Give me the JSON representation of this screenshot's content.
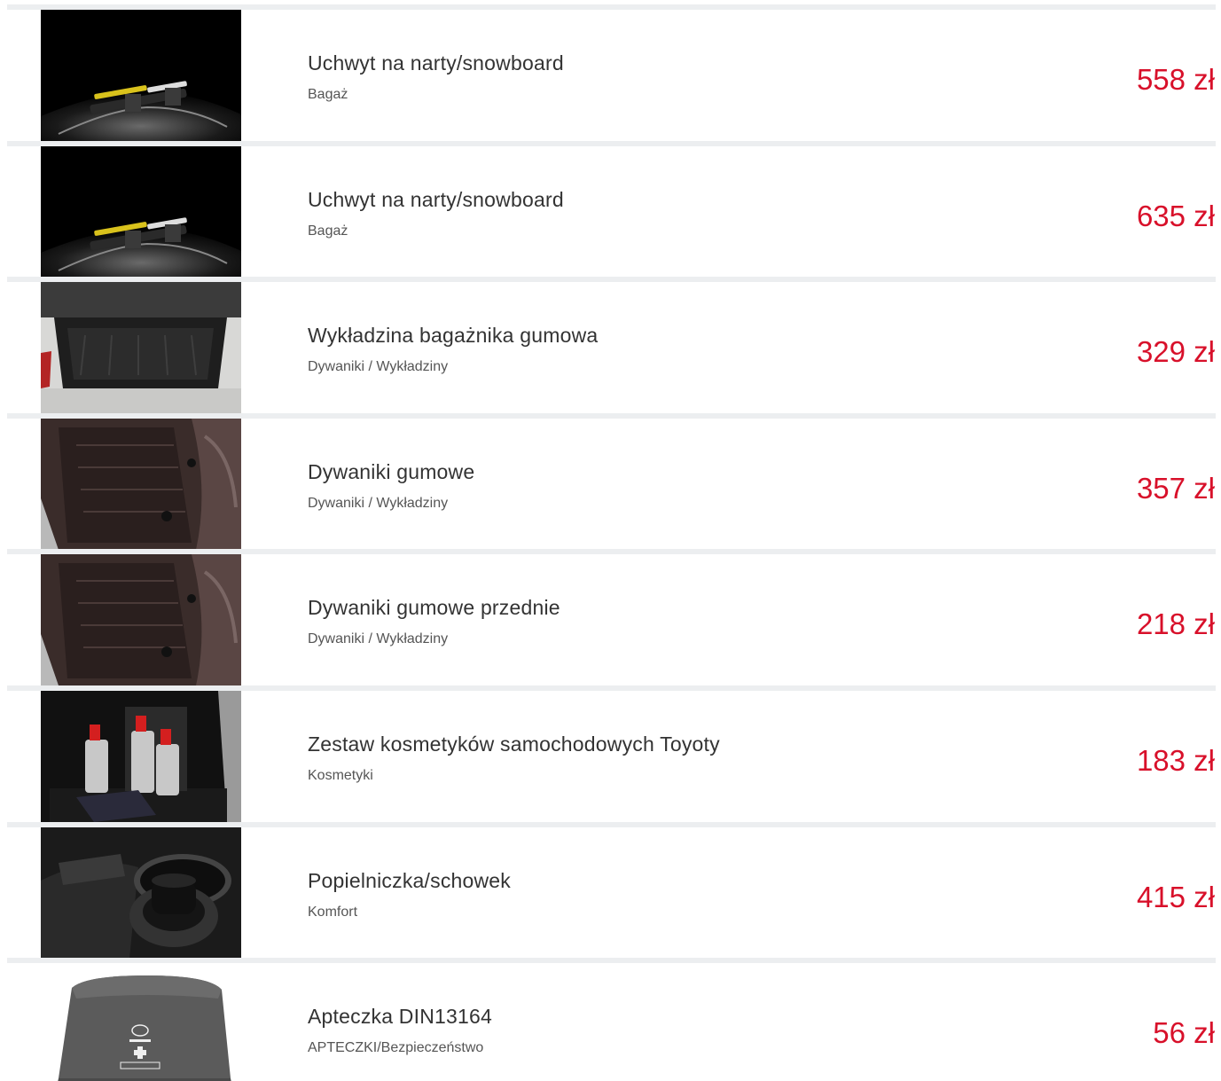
{
  "accent_color": "#d8102a",
  "products": [
    {
      "name": "Uchwyt na narty/snowboard",
      "category": "Bagaż",
      "price": "558 zł",
      "image_icon": "ski-rack-image"
    },
    {
      "name": "Uchwyt na narty/snowboard",
      "category": "Bagaż",
      "price": "635 zł",
      "image_icon": "ski-rack-image"
    },
    {
      "name": "Wykładzina bagażnika gumowa",
      "category": "Dywaniki / Wykładziny",
      "price": "329 zł",
      "image_icon": "trunk-mat-image"
    },
    {
      "name": "Dywaniki gumowe",
      "category": "Dywaniki / Wykładziny",
      "price": "357 zł",
      "image_icon": "floor-mat-image"
    },
    {
      "name": "Dywaniki gumowe przednie",
      "category": "Dywaniki / Wykładziny",
      "price": "218 zł",
      "image_icon": "floor-mat-image"
    },
    {
      "name": "Zestaw kosmetyków samochodowych Toyoty",
      "category": "Kosmetyki",
      "price": "183 zł",
      "image_icon": "cosmetics-kit-image"
    },
    {
      "name": "Popielniczka/schowek",
      "category": "Komfort",
      "price": "415 zł",
      "image_icon": "ashtray-image"
    },
    {
      "name": "Apteczka DIN13164",
      "category": "APTECZKI/Bezpieczeństwo",
      "price": "56 zł",
      "image_icon": "first-aid-kit-image"
    }
  ]
}
